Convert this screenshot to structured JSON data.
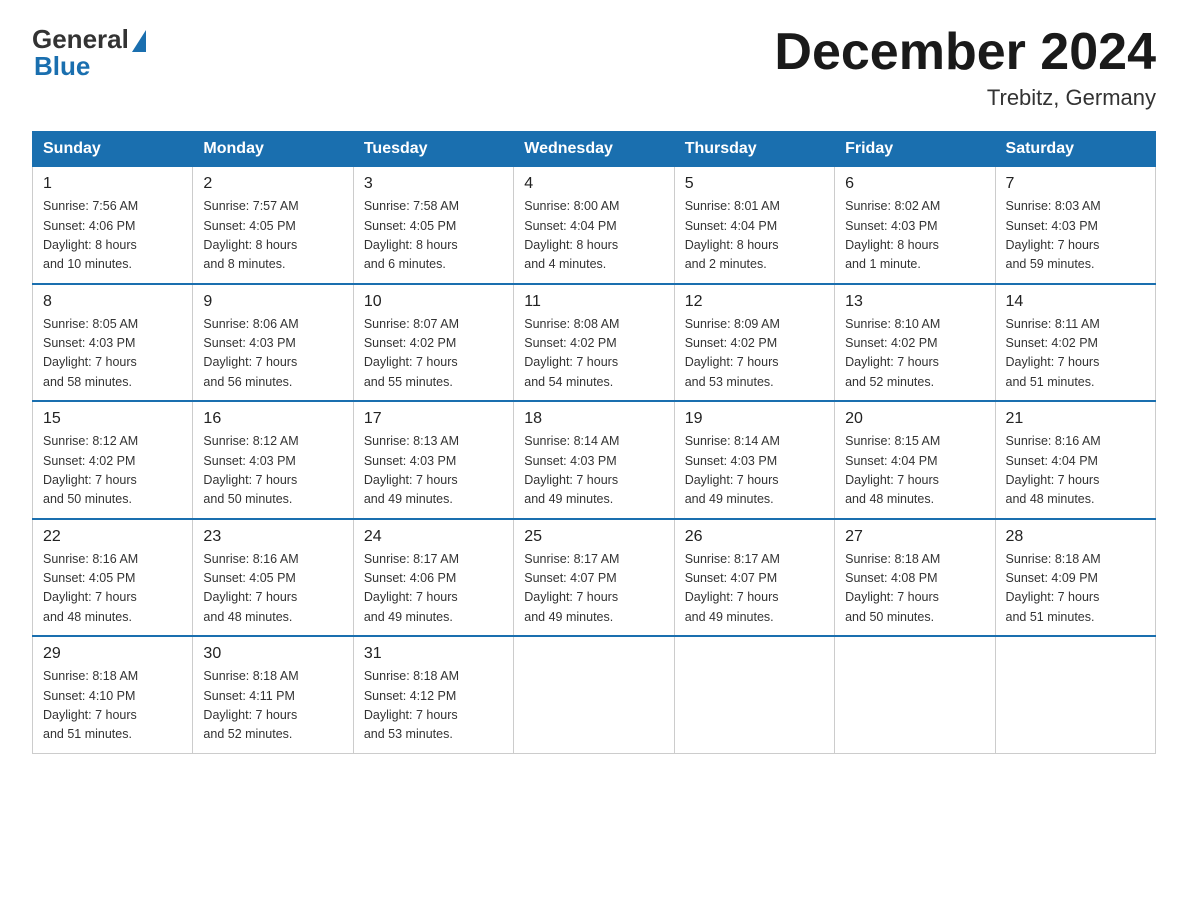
{
  "header": {
    "logo_general": "General",
    "logo_blue": "Blue",
    "month_title": "December 2024",
    "location": "Trebitz, Germany"
  },
  "days_of_week": [
    "Sunday",
    "Monday",
    "Tuesday",
    "Wednesday",
    "Thursday",
    "Friday",
    "Saturday"
  ],
  "weeks": [
    [
      {
        "day": "1",
        "sunrise": "7:56 AM",
        "sunset": "4:06 PM",
        "daylight": "8 hours and 10 minutes."
      },
      {
        "day": "2",
        "sunrise": "7:57 AM",
        "sunset": "4:05 PM",
        "daylight": "8 hours and 8 minutes."
      },
      {
        "day": "3",
        "sunrise": "7:58 AM",
        "sunset": "4:05 PM",
        "daylight": "8 hours and 6 minutes."
      },
      {
        "day": "4",
        "sunrise": "8:00 AM",
        "sunset": "4:04 PM",
        "daylight": "8 hours and 4 minutes."
      },
      {
        "day": "5",
        "sunrise": "8:01 AM",
        "sunset": "4:04 PM",
        "daylight": "8 hours and 2 minutes."
      },
      {
        "day": "6",
        "sunrise": "8:02 AM",
        "sunset": "4:03 PM",
        "daylight": "8 hours and 1 minute."
      },
      {
        "day": "7",
        "sunrise": "8:03 AM",
        "sunset": "4:03 PM",
        "daylight": "7 hours and 59 minutes."
      }
    ],
    [
      {
        "day": "8",
        "sunrise": "8:05 AM",
        "sunset": "4:03 PM",
        "daylight": "7 hours and 58 minutes."
      },
      {
        "day": "9",
        "sunrise": "8:06 AM",
        "sunset": "4:03 PM",
        "daylight": "7 hours and 56 minutes."
      },
      {
        "day": "10",
        "sunrise": "8:07 AM",
        "sunset": "4:02 PM",
        "daylight": "7 hours and 55 minutes."
      },
      {
        "day": "11",
        "sunrise": "8:08 AM",
        "sunset": "4:02 PM",
        "daylight": "7 hours and 54 minutes."
      },
      {
        "day": "12",
        "sunrise": "8:09 AM",
        "sunset": "4:02 PM",
        "daylight": "7 hours and 53 minutes."
      },
      {
        "day": "13",
        "sunrise": "8:10 AM",
        "sunset": "4:02 PM",
        "daylight": "7 hours and 52 minutes."
      },
      {
        "day": "14",
        "sunrise": "8:11 AM",
        "sunset": "4:02 PM",
        "daylight": "7 hours and 51 minutes."
      }
    ],
    [
      {
        "day": "15",
        "sunrise": "8:12 AM",
        "sunset": "4:02 PM",
        "daylight": "7 hours and 50 minutes."
      },
      {
        "day": "16",
        "sunrise": "8:12 AM",
        "sunset": "4:03 PM",
        "daylight": "7 hours and 50 minutes."
      },
      {
        "day": "17",
        "sunrise": "8:13 AM",
        "sunset": "4:03 PM",
        "daylight": "7 hours and 49 minutes."
      },
      {
        "day": "18",
        "sunrise": "8:14 AM",
        "sunset": "4:03 PM",
        "daylight": "7 hours and 49 minutes."
      },
      {
        "day": "19",
        "sunrise": "8:14 AM",
        "sunset": "4:03 PM",
        "daylight": "7 hours and 49 minutes."
      },
      {
        "day": "20",
        "sunrise": "8:15 AM",
        "sunset": "4:04 PM",
        "daylight": "7 hours and 48 minutes."
      },
      {
        "day": "21",
        "sunrise": "8:16 AM",
        "sunset": "4:04 PM",
        "daylight": "7 hours and 48 minutes."
      }
    ],
    [
      {
        "day": "22",
        "sunrise": "8:16 AM",
        "sunset": "4:05 PM",
        "daylight": "7 hours and 48 minutes."
      },
      {
        "day": "23",
        "sunrise": "8:16 AM",
        "sunset": "4:05 PM",
        "daylight": "7 hours and 48 minutes."
      },
      {
        "day": "24",
        "sunrise": "8:17 AM",
        "sunset": "4:06 PM",
        "daylight": "7 hours and 49 minutes."
      },
      {
        "day": "25",
        "sunrise": "8:17 AM",
        "sunset": "4:07 PM",
        "daylight": "7 hours and 49 minutes."
      },
      {
        "day": "26",
        "sunrise": "8:17 AM",
        "sunset": "4:07 PM",
        "daylight": "7 hours and 49 minutes."
      },
      {
        "day": "27",
        "sunrise": "8:18 AM",
        "sunset": "4:08 PM",
        "daylight": "7 hours and 50 minutes."
      },
      {
        "day": "28",
        "sunrise": "8:18 AM",
        "sunset": "4:09 PM",
        "daylight": "7 hours and 51 minutes."
      }
    ],
    [
      {
        "day": "29",
        "sunrise": "8:18 AM",
        "sunset": "4:10 PM",
        "daylight": "7 hours and 51 minutes."
      },
      {
        "day": "30",
        "sunrise": "8:18 AM",
        "sunset": "4:11 PM",
        "daylight": "7 hours and 52 minutes."
      },
      {
        "day": "31",
        "sunrise": "8:18 AM",
        "sunset": "4:12 PM",
        "daylight": "7 hours and 53 minutes."
      },
      null,
      null,
      null,
      null
    ]
  ],
  "labels": {
    "sunrise": "Sunrise:",
    "sunset": "Sunset:",
    "daylight": "Daylight:"
  }
}
